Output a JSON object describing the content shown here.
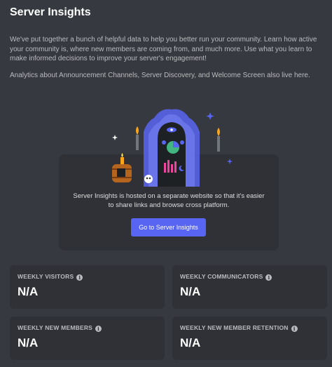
{
  "header": {
    "title": "Server Insights"
  },
  "intro": {
    "paragraph1": "We've put together a bunch of helpful data to help you better run your community. Learn how active your community is, where new members are coming from, and much more. Use what you learn to make informed decisions to improve your server's engagement!",
    "paragraph2": "Analytics about Announcement Channels, Server Discovery, and Welcome Screen also live here."
  },
  "promo": {
    "text": "Server Insights is hosted on a separate website so that it's easier to share links and browse cross platform.",
    "button_label": "Go to Server Insights"
  },
  "stats": [
    {
      "label": "WEEKLY VISITORS",
      "value": "N/A",
      "icon": "info-icon"
    },
    {
      "label": "WEEKLY COMMUNICATORS",
      "value": "N/A",
      "icon": "info-icon"
    },
    {
      "label": "WEEKLY NEW MEMBERS",
      "value": "N/A",
      "icon": "info-icon"
    },
    {
      "label": "WEEKLY NEW MEMBER RETENTION",
      "value": "N/A",
      "icon": "info-icon"
    }
  ],
  "colors": {
    "background": "#36393f",
    "card": "#2f3136",
    "accent": "#5865f2",
    "text_muted": "#b9bbbe",
    "text_bright": "#ffffff"
  }
}
